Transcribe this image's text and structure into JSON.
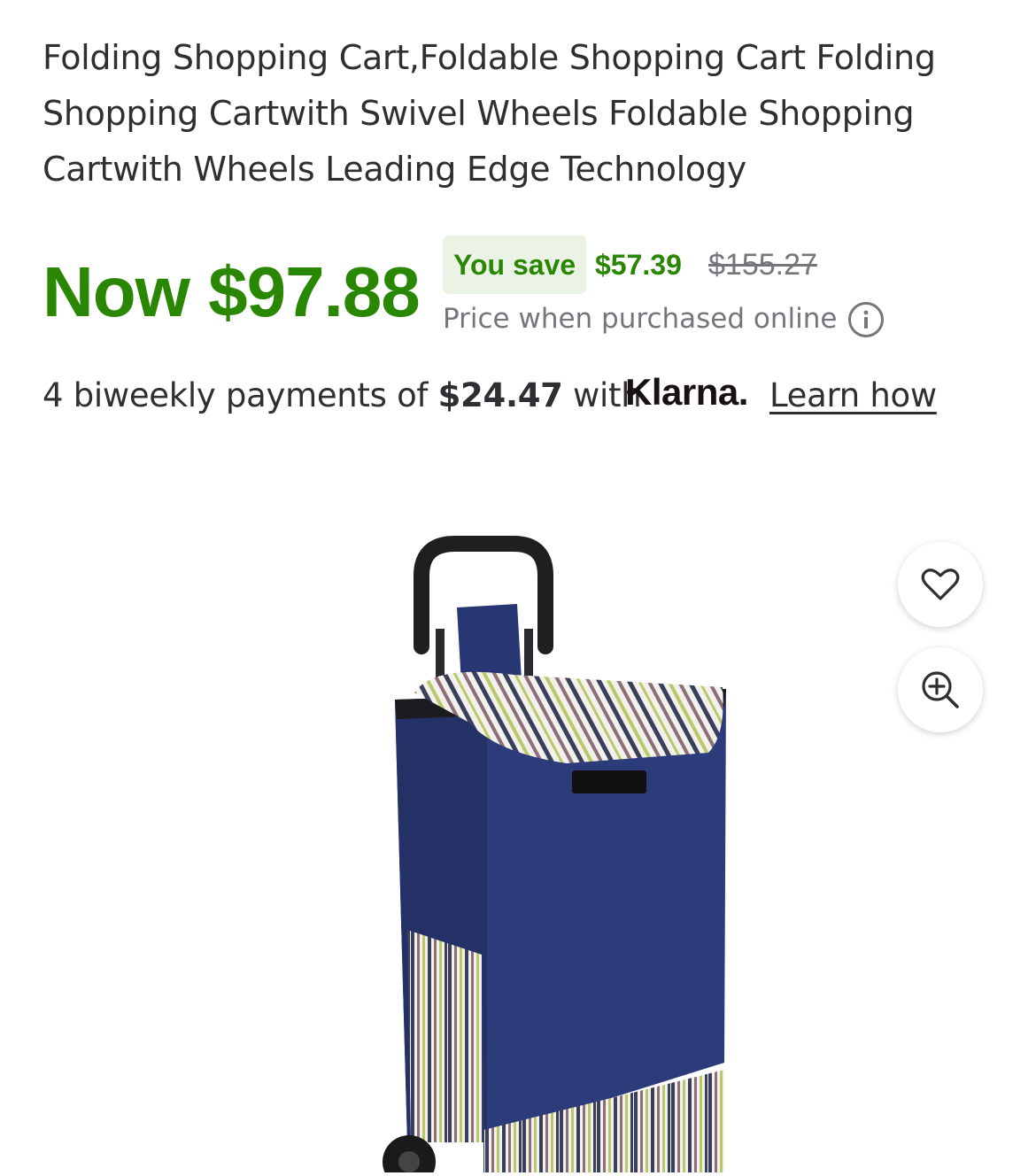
{
  "product": {
    "title": "Folding Shopping Cart,Foldable Shopping Cart Folding Shopping Cartwith Swivel Wheels Foldable Shopping Cartwith Wheels Leading Edge Technology"
  },
  "pricing": {
    "now_label": "Now $97.88",
    "you_save_label": "You save",
    "save_amount": "$57.39",
    "was_price": "$155.27",
    "price_note": "Price when purchased online",
    "accent_color": "#2a8703",
    "badge_bg_color": "#eaf3e6"
  },
  "financing": {
    "prefix": "4 biweekly payments of ",
    "amount": "$24.47",
    "suffix": " with",
    "provider_logo": "Klarna.",
    "link_label": "Learn how"
  },
  "media": {
    "favorite_icon": "heart-icon",
    "zoom_icon": "zoom-in-icon",
    "info_icon": "info-icon"
  }
}
